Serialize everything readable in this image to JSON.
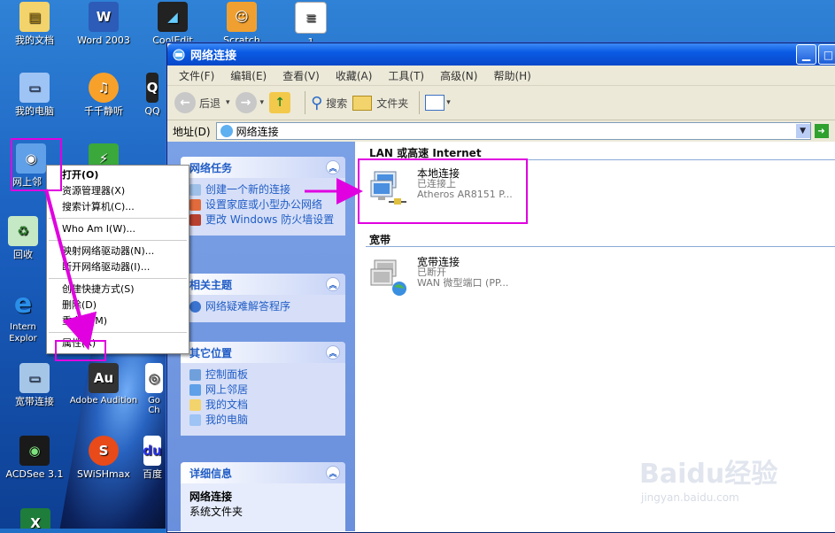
{
  "desktop": {
    "icons": [
      {
        "label": "我的文档"
      },
      {
        "label": "Word 2003"
      },
      {
        "label": "CoolEdit"
      },
      {
        "label": "Scratch"
      },
      {
        "label": "1"
      },
      {
        "label": "我的电脑"
      },
      {
        "label": "千千静听"
      },
      {
        "label": "QQ"
      },
      {
        "label": "网上邻"
      },
      {
        "label": "回收"
      },
      {
        "label": "Intern Explor"
      },
      {
        "label": "宽带连接"
      },
      {
        "label": "Adobe Audition"
      },
      {
        "label": "Go Ch"
      },
      {
        "label": "ACDSee 3.1"
      },
      {
        "label": "SWiSHmax"
      },
      {
        "label": "百度"
      }
    ]
  },
  "context_menu": {
    "items": [
      "打开(O)",
      "资源管理器(X)",
      "搜索计算机(C)...",
      "Who Am I(W)...",
      "映射网络驱动器(N)...",
      "断开网络驱动器(I)...",
      "创建快捷方式(S)",
      "删除(D)",
      "重命名(M)",
      "属性(R)"
    ]
  },
  "window": {
    "title": "网络连接",
    "menu": [
      "文件(F)",
      "编辑(E)",
      "查看(V)",
      "收藏(A)",
      "工具(T)",
      "高级(N)",
      "帮助(H)"
    ],
    "toolbar": {
      "back": "后退",
      "search": "搜索",
      "folders": "文件夹"
    },
    "address": {
      "label": "地址(D)",
      "value": "网络连接"
    }
  },
  "left_panel": {
    "tasks": {
      "title": "网络任务",
      "links": [
        "创建一个新的连接",
        "设置家庭或小型办公网络",
        "更改 Windows 防火墙设置"
      ]
    },
    "related": {
      "title": "相关主题",
      "links": [
        "网络疑难解答程序"
      ]
    },
    "other": {
      "title": "其它位置",
      "links": [
        "控制面板",
        "网上邻居",
        "我的文档",
        "我的电脑"
      ]
    },
    "details": {
      "title": "详细信息",
      "name": "网络连接",
      "type": "系统文件夹"
    }
  },
  "content": {
    "lan_header": "LAN 或高速 Internet",
    "lan_conn": {
      "name": "本地连接",
      "status": "已连接上",
      "device": "Atheros AR8151 P..."
    },
    "broadband_header": "宽带",
    "bb_conn": {
      "name": "宽带连接",
      "status": "已断开",
      "device": "WAN 微型端口 (PP..."
    }
  },
  "watermark": {
    "brand": "Baidu经验",
    "url": "jingyan.baidu.com"
  },
  "colors": {
    "highlight": "#e000e0",
    "link": "#215dc6",
    "titlebar": "#0a5be4"
  }
}
